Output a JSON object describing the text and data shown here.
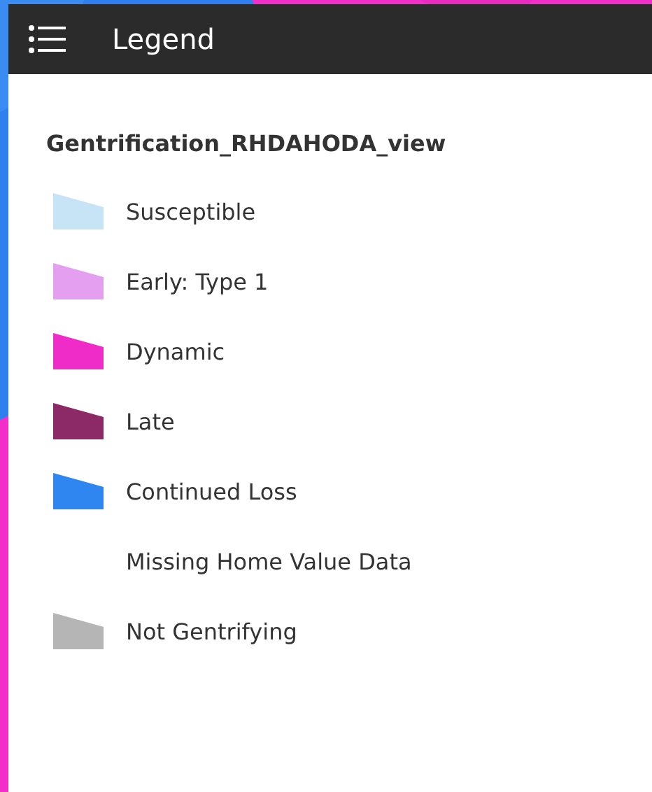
{
  "header": {
    "title": "Legend"
  },
  "layer": {
    "title": "Gentrification_RHDAHODA_view"
  },
  "items": [
    {
      "label": "Susceptible",
      "color": "#c6e4f6"
    },
    {
      "label": "Early: Type 1",
      "color": "#e49ff0"
    },
    {
      "label": "Dynamic",
      "color": "#f02cc8"
    },
    {
      "label": "Late",
      "color": "#8c2a68"
    },
    {
      "label": "Continued Loss",
      "color": "#2f86f0"
    },
    {
      "label": "Missing Home Value Data"
    },
    {
      "label": "Not Gentrifying",
      "color": "#b5b5b5"
    }
  ]
}
